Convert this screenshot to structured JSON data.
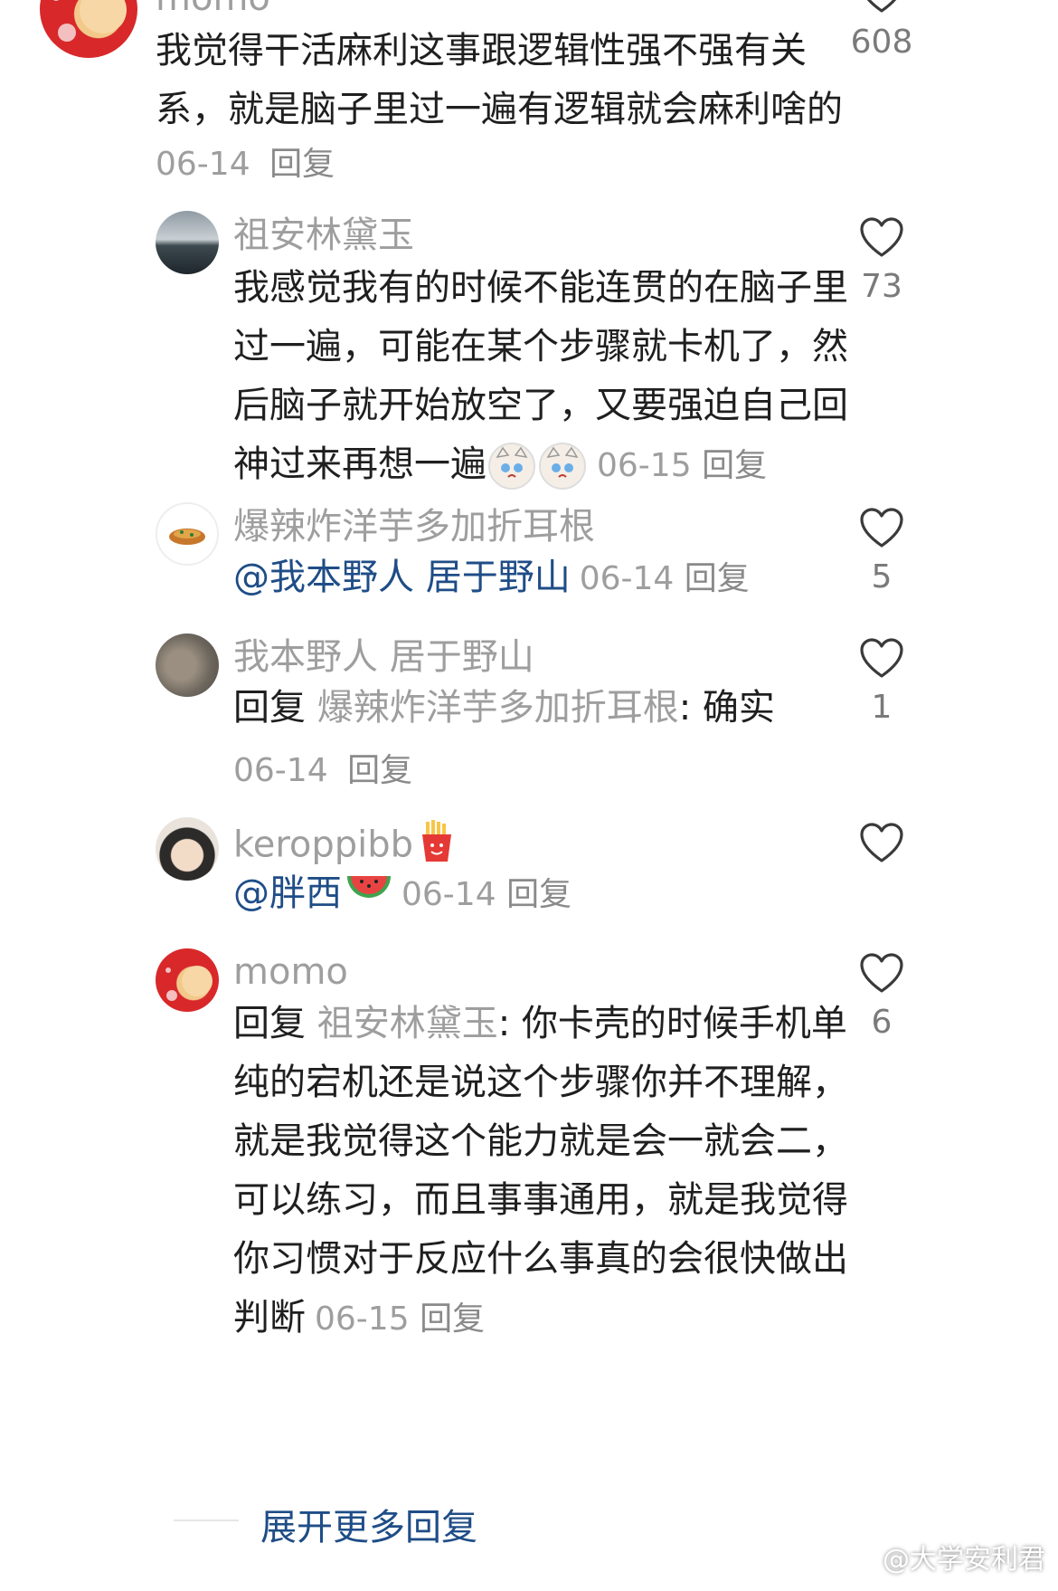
{
  "comments": [
    {
      "username": "momo",
      "lines": [
        "我觉得干活麻利这事跟逻辑性强不强有关",
        "系，就是脑子里过一遍有逻辑就会麻利啥的"
      ],
      "date": "06-14",
      "reply_label": "回复",
      "likes": "608"
    },
    {
      "username": "祖安林黛玉",
      "lines": [
        "我感觉我有的时候不能连贯的在脑子里",
        "过一遍，可能在某个步骤就卡机了，然",
        "后脑子就开始放空了，又要强迫自己回",
        "神过来再想一遍"
      ],
      "date": "06-15",
      "reply_label": "回复",
      "likes": "73"
    },
    {
      "username": "爆辣炸洋芋多加折耳根",
      "mention": "@我本野人 居于野山",
      "date": "06-14",
      "reply_label": "回复",
      "likes": "5"
    },
    {
      "username": "我本野人 居于野山",
      "reply_prefix": "回复",
      "reply_to": "爆辣炸洋芋多加折耳根",
      "text": ": 确实",
      "date": "06-14",
      "reply_label": "回复",
      "likes": "1"
    },
    {
      "username": "keroppibb",
      "mention": "@胖西",
      "date": "06-14",
      "reply_label": "回复",
      "likes": ""
    },
    {
      "username": "momo",
      "reply_prefix": "回复",
      "reply_to": "祖安林黛玉",
      "first_line_text": ": 你卡壳的时候手机单",
      "lines": [
        "纯的宕机还是说这个步骤你并不理解，",
        "就是我觉得这个能力就是会一就会二，",
        "可以练习，而且事事通用，就是我觉得",
        "你习惯对于反应什么事真的会很快做出",
        "判断"
      ],
      "date": "06-15",
      "reply_label": "回复",
      "likes": "6"
    }
  ],
  "expand_more": "展开更多回复",
  "watermark": "@大学安利君",
  "colors": {
    "mention": "#1f4d87",
    "muted": "#9e9e9e",
    "text": "#1f1f1f"
  },
  "icons": {
    "like": "heart-outline-icon",
    "emoji_cat": "crying-cat-emoji",
    "emoji_fries": "french-fries-emoji",
    "emoji_watermelon": "watermelon-emoji",
    "weibo": "weibo-logo-icon"
  }
}
